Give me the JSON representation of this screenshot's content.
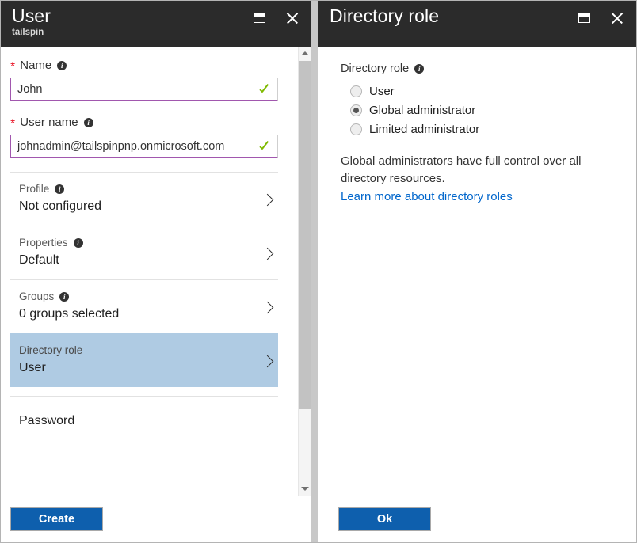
{
  "left_blade": {
    "title": "User",
    "subtitle": "tailspin",
    "maximize_label": "Maximize",
    "close_label": "Close",
    "fields": [
      {
        "label": "Name",
        "required": true,
        "has_info": true,
        "value": "John",
        "valid": true
      },
      {
        "label": "User name",
        "required": true,
        "has_info": true,
        "value": "johnadmin@tailspinpnp.onmicrosoft.com",
        "valid": true
      }
    ],
    "rows": [
      {
        "label": "Profile",
        "value": "Not configured",
        "has_info": true,
        "selected": false
      },
      {
        "label": "Properties",
        "value": "Default",
        "has_info": true,
        "selected": false
      },
      {
        "label": "Groups",
        "value": "0 groups selected",
        "has_info": true,
        "selected": false
      },
      {
        "label": "Directory role",
        "value": "User",
        "has_info": false,
        "selected": true
      }
    ],
    "password_label": "Password",
    "footer_button": "Create"
  },
  "right_blade": {
    "title": "Directory role",
    "maximize_label": "Maximize",
    "close_label": "Close",
    "field_label": "Directory role",
    "options": [
      {
        "label": "User",
        "selected": false
      },
      {
        "label": "Global administrator",
        "selected": true
      },
      {
        "label": "Limited administrator",
        "selected": false
      }
    ],
    "description": "Global administrators have full control over all directory resources.",
    "link_text": "Learn more about directory roles",
    "footer_button": "Ok"
  },
  "colors": {
    "header_bg": "#2b2b2b",
    "accent_blue": "#0e5fad",
    "link_blue": "#0066cc",
    "selected_row": "#afcbe3",
    "valid_green": "#7fba00",
    "required_red": "#e81123",
    "input_underline": "#a157ae"
  },
  "icons": {
    "info": "i",
    "chevron_right": "chevron-right-icon",
    "check": "check-icon"
  }
}
